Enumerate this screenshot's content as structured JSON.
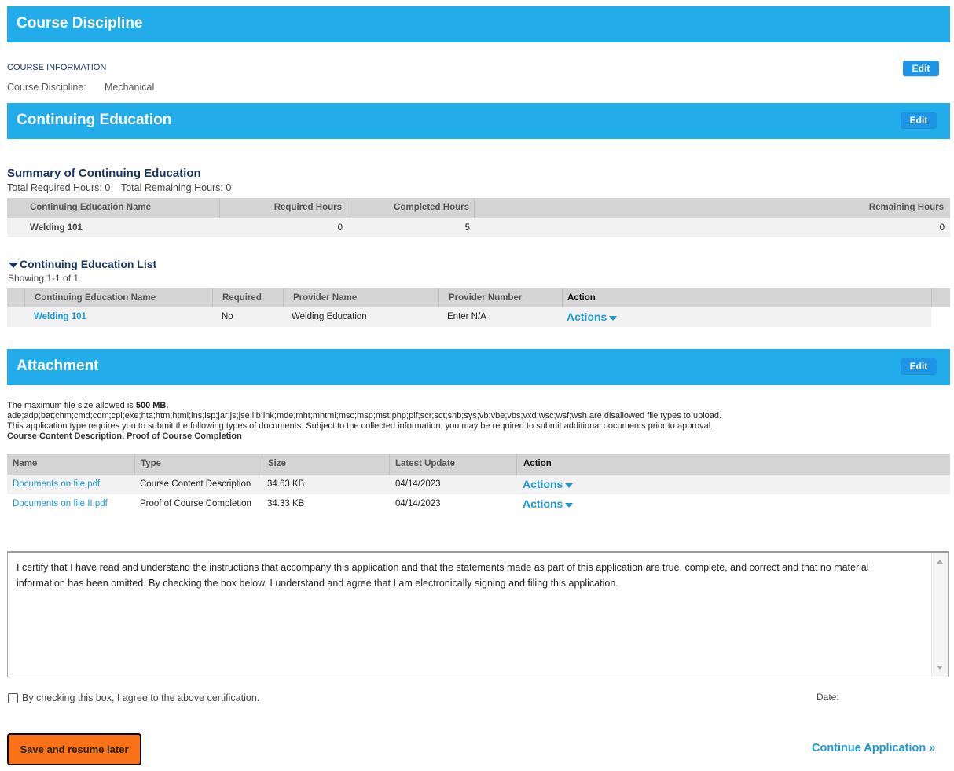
{
  "course_discipline": {
    "title": "Course Discipline",
    "info_label": "COURSE INFORMATION",
    "edit_label": "Edit",
    "field_label": "Course Discipline:",
    "field_value": "Mechanical"
  },
  "continuing_education": {
    "title": "Continuing Education",
    "edit_label": "Edit",
    "summary": {
      "heading": "Summary of Continuing Education",
      "totals": "Total Required Hours: 0    Total Remaining Hours: 0",
      "headers": [
        "Continuing Education Name",
        "Required Hours",
        "Completed Hours",
        "Remaining Hours"
      ],
      "rows": [
        {
          "name": "Welding 101",
          "required": "0",
          "completed": "5",
          "remaining": "0"
        }
      ]
    },
    "list": {
      "heading": "Continuing Education List",
      "showing": "Showing 1-1 of 1",
      "headers": [
        "Continuing Education Name",
        "Required",
        "Provider Name",
        "Provider Number",
        "Action"
      ],
      "rows": [
        {
          "name": "Welding 101",
          "required": "No",
          "provider": "Welding Education",
          "provider_number": "Enter N/A",
          "action": "Actions"
        }
      ]
    }
  },
  "attachment": {
    "title": "Attachment",
    "edit_label": "Edit",
    "max_size_prefix": "The maximum file size allowed is ",
    "max_size_value": "500 MB.",
    "disallowed": "ade;adp;bat;chm;cmd;com;cpl;exe;hta;htm;html;ins;isp;jar;js;jse;lib;lnk;mde;mht;mhtml;msc;msp;mst;php;pif;scr;sct;shb;sys;vb;vbe;vbs;vxd;wsc;wsf;wsh are disallowed file types to upload.",
    "requirement": "This application type requires you to submit the following types of documents. Subject to the collected information, you may be required to submit additional documents prior to approval.",
    "required_docs": "Course Content Description, Proof of Course Completion",
    "headers": [
      "Name",
      "Type",
      "Size",
      "Latest Update",
      "Action"
    ],
    "rows": [
      {
        "name": "Documents on file.pdf",
        "type": "Course Content Description",
        "size": "34.63 KB",
        "date": "04/14/2023",
        "action": "Actions"
      },
      {
        "name": "Documents on file II.pdf",
        "type": "Proof of Course Completion",
        "size": "34.33 KB",
        "date": "04/14/2023",
        "action": "Actions"
      }
    ]
  },
  "certification": {
    "text": "I certify that I have read and understand the instructions that accompany this application and that the statements made as part of this application are true, complete, and correct and that no material information has been omitted. By checking the box below, I understand and agree that I am electronically signing and filing this application.",
    "checkbox_label": "By checking this box, I agree to the above certification.",
    "date_label": "Date:"
  },
  "footer": {
    "save_label": "Save and resume later",
    "continue_label": "Continue Application »"
  },
  "colors": {
    "banner": "#22ace9",
    "edit_button": "#1d94e6",
    "link": "#1d9ad6",
    "heading": "#16355f",
    "save_button": "#fb7319"
  }
}
